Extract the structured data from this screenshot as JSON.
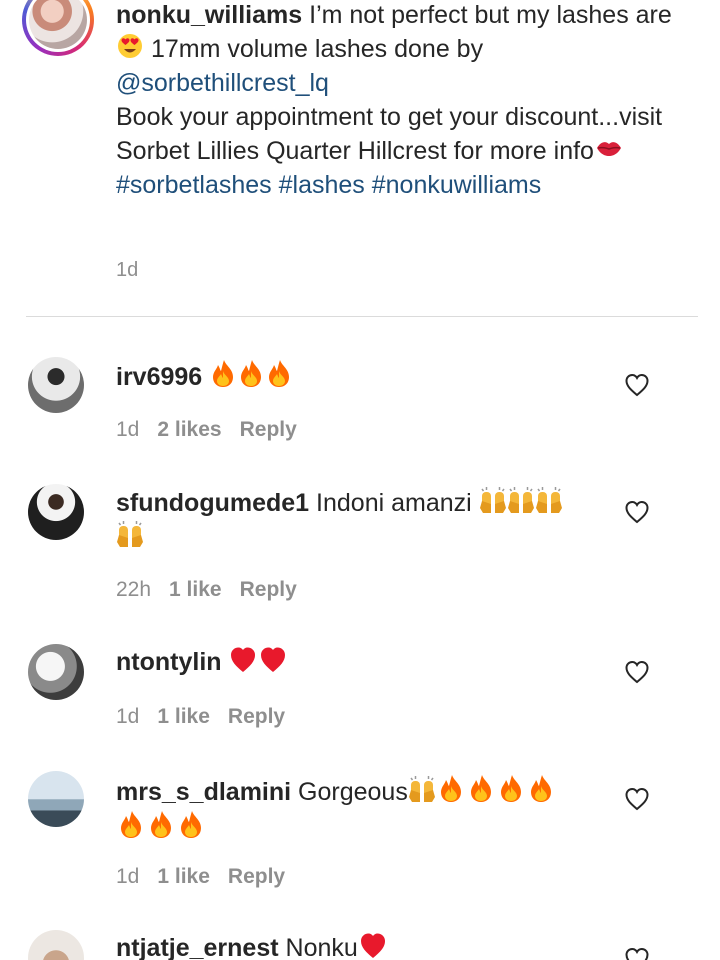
{
  "caption": {
    "username": "nonku_williams",
    "text_1": "I’m not perfect but my lashes are",
    "text_2": "17mm volume lashes done by",
    "mention": "@sorbethillcrest_lq",
    "text_3": "Book your appointment to get your discount...visit Sorbet Lillies Quarter Hillcrest for more info",
    "hashtags": [
      "#sorbetlashes",
      "#lashes",
      "#nonkuwilliams"
    ],
    "time": "1d",
    "emojis": [
      "heart-eyes-emoji",
      "lips-emoji"
    ]
  },
  "comments": [
    {
      "username": "irv6996",
      "text": "",
      "emoji": "fire-emoji",
      "emoji_count": 3,
      "time": "1d",
      "likes": "2 likes",
      "reply": "Reply"
    },
    {
      "username": "sfundogumede1",
      "text": "Indoni amanzi",
      "emoji": "raising-hands-emoji",
      "emoji_count": 4,
      "time": "22h",
      "likes": "1 like",
      "reply": "Reply"
    },
    {
      "username": "ntontylin",
      "text": "",
      "emoji": "red-heart-emoji",
      "emoji_count": 2,
      "time": "1d",
      "likes": "1 like",
      "reply": "Reply"
    },
    {
      "username": "mrs_s_dlamini",
      "text": "Gorgeous",
      "emoji": "raising-hands-and-fire-emoji",
      "emoji_count": 8,
      "time": "1d",
      "likes": "1 like",
      "reply": "Reply"
    },
    {
      "username": "ntjatje_ernest",
      "text": "Nonku",
      "emoji": "red-heart-emoji",
      "emoji_count": 1
    }
  ],
  "colors": {
    "text": "#262626",
    "secondary": "#8e8e8e",
    "link": "#1f4f7a",
    "divider": "#dbdbdb",
    "fire": "#ff5a1f",
    "heart": "#e8192c"
  },
  "icons": {
    "like": "heart-outline-icon"
  }
}
